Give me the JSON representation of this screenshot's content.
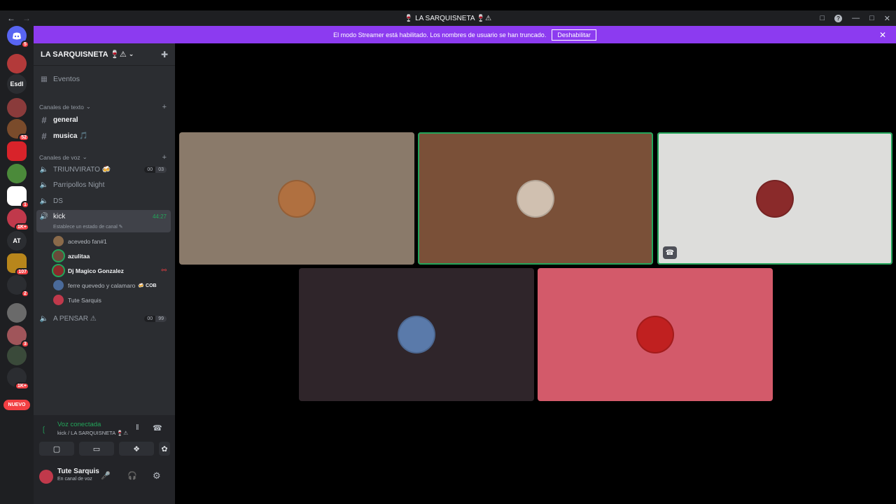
{
  "window": {
    "title": "🍷 LA SARQUISNETA 🍷⚠",
    "back": "←",
    "forward": "→",
    "controls": [
      "―",
      "□",
      "✕"
    ]
  },
  "banner": {
    "text": "El modo Streamer está habilitado. Los nombres de usuario se han truncado.",
    "button": "Deshabilitar",
    "close": "✕"
  },
  "servers": [
    {
      "label": "",
      "badge": "5",
      "color": "#5865f2",
      "icon": "discord-icon"
    },
    {
      "label": "",
      "badge": "",
      "color": "#b33a3a",
      "icon": "server-avatar"
    },
    {
      "label": "Esdl",
      "badge": "",
      "color": "#2b2d31"
    },
    {
      "label": "",
      "badge": "",
      "color": "#8a3b3b"
    },
    {
      "label": "",
      "badge": "52",
      "color": "#7a4b2b"
    },
    {
      "label": "",
      "badge": "",
      "color": "#d8232a"
    },
    {
      "label": "",
      "badge": "",
      "color": "#4b8a3a"
    },
    {
      "label": "",
      "badge": "1",
      "color": "#ffffff"
    },
    {
      "label": "",
      "badge": "1K+",
      "color": "#c0394b"
    },
    {
      "label": "AT",
      "badge": "",
      "color": "#2b2d31"
    },
    {
      "label": "",
      "badge": "107",
      "color": "#b8861b"
    },
    {
      "label": "",
      "badge": "2",
      "color": "#2b2d31"
    },
    {
      "label": "",
      "badge": "",
      "color": "#6a6a6a"
    },
    {
      "label": "",
      "badge": "3",
      "color": "#a0555a"
    },
    {
      "label": "",
      "badge": "",
      "color": "#3a4a3a"
    },
    {
      "label": "",
      "badge": "1K+",
      "color": "#2b2d31"
    }
  ],
  "nuevo": "NUEVO",
  "guild": {
    "name": "LA SARQUISNETA 🍷⚠",
    "events": "Eventos",
    "text_category": "Canales de texto",
    "text_channels": [
      {
        "name": "general"
      },
      {
        "name": "musica 🎵"
      }
    ],
    "voice_category": "Canales de voz",
    "voice_channels": [
      {
        "name": "TRIUNVIRATO 🍻",
        "count_a": "00",
        "count_b": "03"
      },
      {
        "name": "Parripollos Night"
      },
      {
        "name": "DS"
      },
      {
        "name": "kick",
        "timer": "44:27",
        "status": "Establece un estado de canal ✎"
      },
      {
        "name": "A PENSAR ⚠",
        "count_a": "00",
        "count_b": "99"
      }
    ],
    "members": [
      {
        "name": "acevedo fan#1",
        "color": "#8a6a4a"
      },
      {
        "name": "azulitaa",
        "color": "#6a4a3a"
      },
      {
        "name": "Dj Magico Gonzalez",
        "color": "#8a2a2a"
      },
      {
        "name": "ferre quevedo y calamaro",
        "color": "#4a6a9a",
        "tag": "🍻 COB"
      },
      {
        "name": "Tute Sarquis",
        "color": "#c0394b"
      }
    ]
  },
  "voice_panel": {
    "status": "Voz conectada",
    "location": "kick / LA SARQUISNETA 🍷⚠"
  },
  "user": {
    "name": "Tute Sarquis",
    "status": "En canal de voz"
  },
  "tiles": [
    {
      "color": "#8a7a6a",
      "avatar": "#b07040",
      "speaking": false
    },
    {
      "color": "#7a5038",
      "avatar": "#d0c0b0",
      "speaking": true
    },
    {
      "color": "#dddddb",
      "avatar": "#8a2a2a",
      "speaking": true
    },
    {
      "color": "#2f252a",
      "avatar": "#5a7aaa",
      "speaking": false
    },
    {
      "color": "#d35a6a",
      "avatar": "#c02020",
      "speaking": false
    }
  ]
}
